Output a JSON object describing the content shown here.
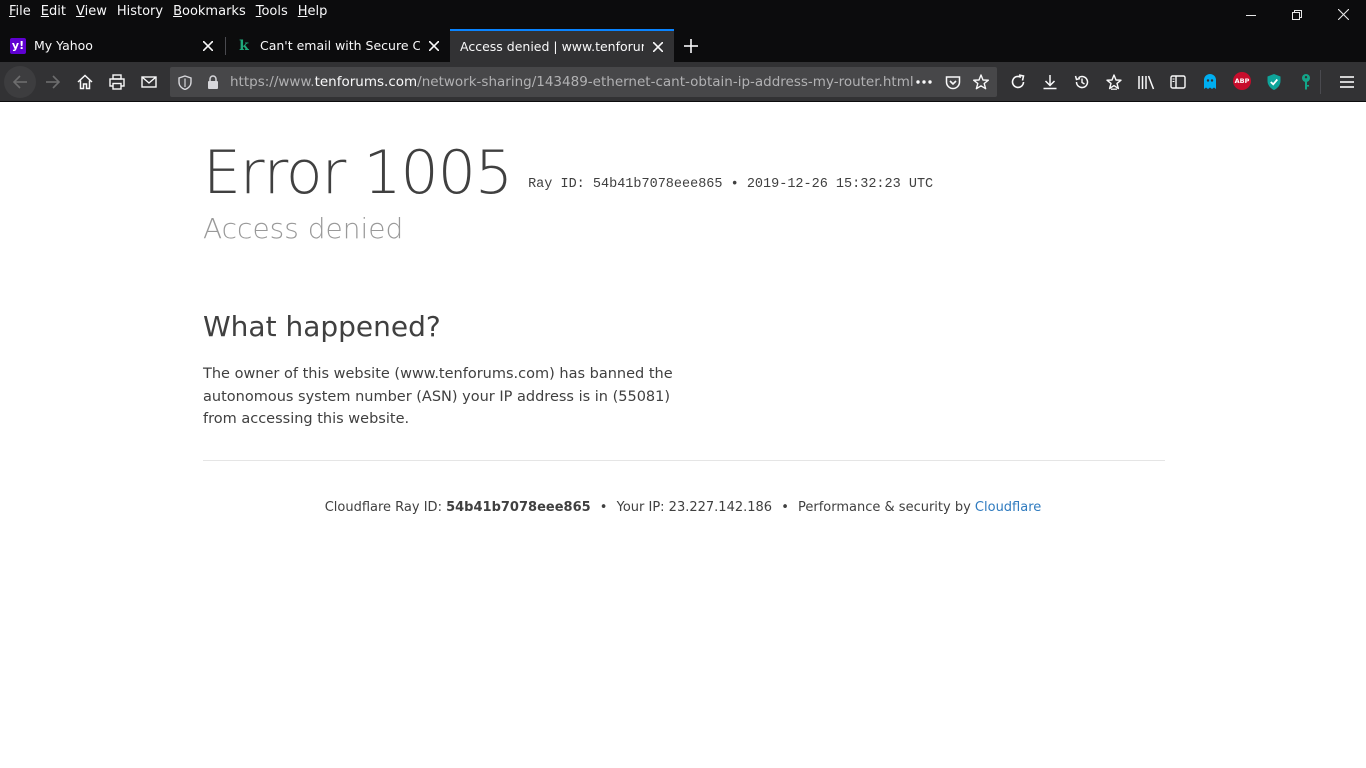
{
  "menu": {
    "items": [
      {
        "label": "File",
        "accel": "F",
        "rest": "ile"
      },
      {
        "label": "Edit",
        "accel": "E",
        "rest": "dit"
      },
      {
        "label": "View",
        "accel": "V",
        "rest": "iew"
      },
      {
        "label": "History",
        "accel": "",
        "rest": "History"
      },
      {
        "label": "Bookmarks",
        "accel": "B",
        "rest": "ookmarks"
      },
      {
        "label": "Tools",
        "accel": "T",
        "rest": "ools"
      },
      {
        "label": "Help",
        "accel": "H",
        "rest": "elp"
      }
    ]
  },
  "tabs": [
    {
      "title": "My Yahoo",
      "favicon": "yahoo-icon",
      "selected": false
    },
    {
      "title": "Can't email with Secure Conne",
      "favicon": "k-icon",
      "selected": false
    },
    {
      "title": "Access denied | www.tenforums.co",
      "favicon": "",
      "selected": true
    }
  ],
  "url": {
    "prefix": "https://www.",
    "host": "tenforums.com",
    "path": "/network-sharing/143489-ethernet-cant-obtain-ip-address-my-router.html"
  },
  "page": {
    "error_code": "Error 1005",
    "ray_line": "Ray ID: 54b41b7078eee865 • 2019-12-26 15:32:23 UTC",
    "subtitle": "Access denied",
    "what_heading": "What happened?",
    "explanation": "The owner of this website (www.tenforums.com) has banned the autonomous system number (ASN) your IP address is in (55081) from accessing this website.",
    "footer": {
      "ray_label": "Cloudflare Ray ID:",
      "ray_id": "54b41b7078eee865",
      "sep": "•",
      "ip_text": "Your IP: 23.227.142.186",
      "perf_text": "Performance & security by",
      "cloudflare_link": "Cloudflare"
    }
  },
  "extensions": {
    "abp_label": "ABP"
  },
  "colors": {
    "accent_tab": "#0a84ff",
    "link": "#2f7bbf",
    "ghostery": "#00aef0",
    "abp": "#c70d2c",
    "shield": "#0ea49a",
    "key": "#13a589"
  }
}
